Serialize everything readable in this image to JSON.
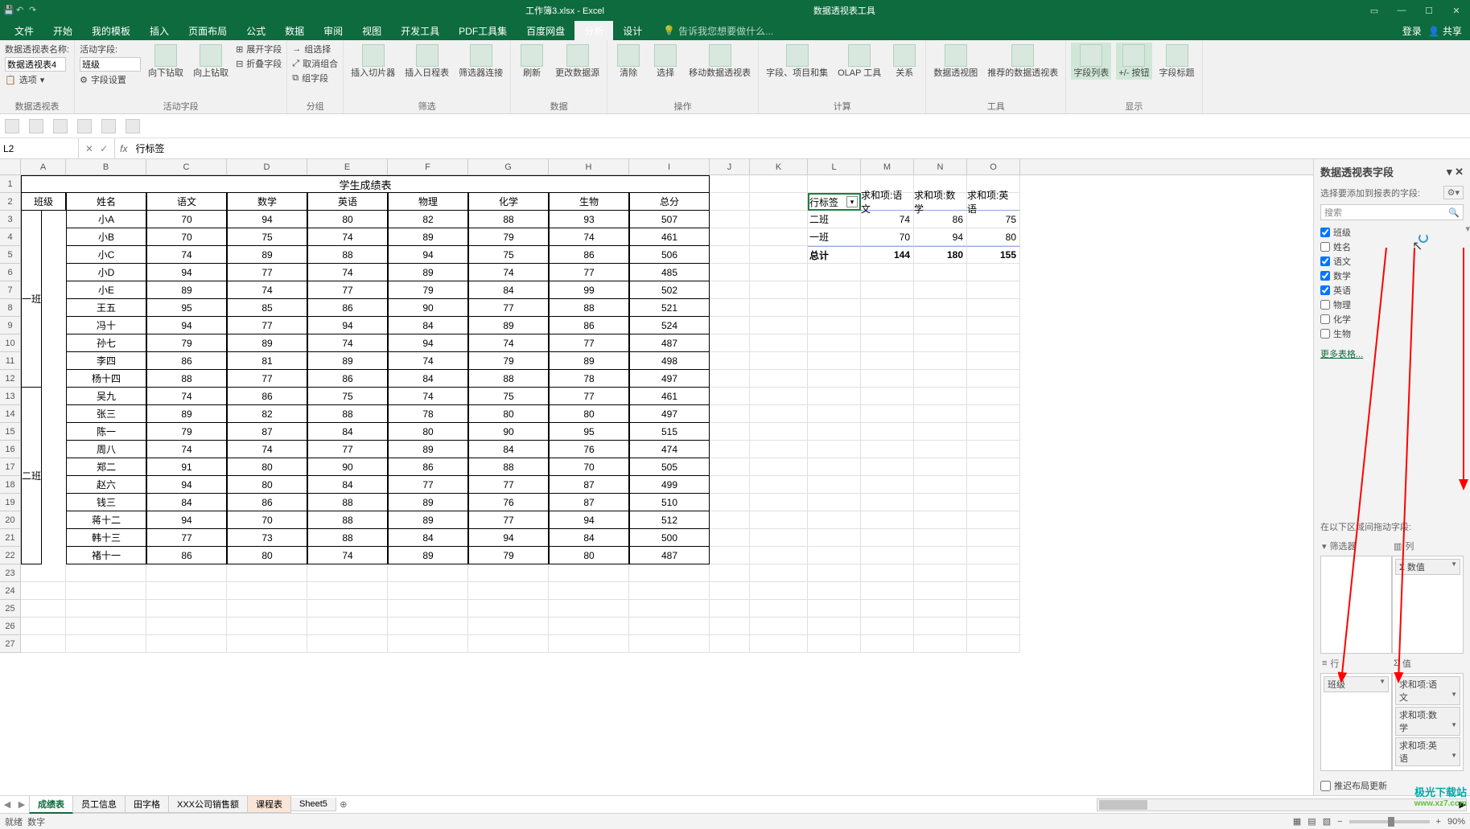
{
  "titlebar": {
    "filename": "工作簿3.xlsx - Excel",
    "context_title": "数据透视表工具",
    "login": "登录",
    "share": "共享"
  },
  "tabs": {
    "file": "文件",
    "home": "开始",
    "templates": "我的模板",
    "insert": "插入",
    "layout": "页面布局",
    "formulas": "公式",
    "data": "数据",
    "review": "审阅",
    "view": "视图",
    "dev": "开发工具",
    "pdf": "PDF工具集",
    "baidu": "百度网盘",
    "analyze": "分析",
    "design": "设计",
    "tell_me": "告诉我您想要做什么..."
  },
  "ribbon": {
    "pt_name_label": "数据透视表名称:",
    "pt_name_value": "数据透视表4",
    "options_btn": "选项",
    "group_pt": "数据透视表",
    "active_field_label": "活动字段:",
    "active_field_value": "班级",
    "field_settings": "字段设置",
    "drill_down": "向下钻取",
    "drill_up": "向上钻取",
    "expand_field": "展开字段",
    "collapse_field": "折叠字段",
    "group_active": "活动字段",
    "group_sel": "组选择",
    "ungroup": "取消组合",
    "group_field": "组字段",
    "group_group": "分组",
    "slicer": "插入切片器",
    "timeline": "插入日程表",
    "filter_conn": "筛选器连接",
    "group_filter": "筛选",
    "refresh": "刷新",
    "change_src": "更改数据源",
    "group_data": "数据",
    "clear": "清除",
    "select": "选择",
    "move": "移动数据透视表",
    "group_actions": "操作",
    "fields_items": "字段、项目和集",
    "olap": "OLAP 工具",
    "relations": "关系",
    "group_calc": "计算",
    "pivot_chart": "数据透视图",
    "recommended": "推荐的数据透视表",
    "group_tools": "工具",
    "field_list": "字段列表",
    "pm_buttons": "+/- 按钮",
    "field_headers": "字段标题",
    "group_show": "显示"
  },
  "namebox": "L2",
  "fx_value": "行标签",
  "columns": [
    "A",
    "B",
    "C",
    "D",
    "E",
    "F",
    "G",
    "H",
    "I",
    "J",
    "K",
    "L",
    "M",
    "N",
    "O"
  ],
  "table": {
    "title": "学生成绩表",
    "headers": [
      "班级",
      "姓名",
      "语文",
      "数学",
      "英语",
      "物理",
      "化学",
      "生物",
      "总分"
    ],
    "class1": "一班",
    "class2": "二班",
    "rows1": [
      [
        "小A",
        "70",
        "94",
        "80",
        "82",
        "88",
        "93",
        "507"
      ],
      [
        "小B",
        "70",
        "75",
        "74",
        "89",
        "79",
        "74",
        "461"
      ],
      [
        "小C",
        "74",
        "89",
        "88",
        "94",
        "75",
        "86",
        "506"
      ],
      [
        "小D",
        "94",
        "77",
        "74",
        "89",
        "74",
        "77",
        "485"
      ],
      [
        "小E",
        "89",
        "74",
        "77",
        "79",
        "84",
        "99",
        "502"
      ],
      [
        "王五",
        "95",
        "85",
        "86",
        "90",
        "77",
        "88",
        "521"
      ],
      [
        "冯十",
        "94",
        "77",
        "94",
        "84",
        "89",
        "86",
        "524"
      ],
      [
        "孙七",
        "79",
        "89",
        "74",
        "94",
        "74",
        "77",
        "487"
      ],
      [
        "李四",
        "86",
        "81",
        "89",
        "74",
        "79",
        "89",
        "498"
      ],
      [
        "杨十四",
        "88",
        "77",
        "86",
        "84",
        "88",
        "78",
        "497"
      ]
    ],
    "rows2": [
      [
        "吴九",
        "74",
        "86",
        "75",
        "74",
        "75",
        "77",
        "461"
      ],
      [
        "张三",
        "89",
        "82",
        "88",
        "78",
        "80",
        "80",
        "497"
      ],
      [
        "陈一",
        "79",
        "87",
        "84",
        "80",
        "90",
        "95",
        "515"
      ],
      [
        "周八",
        "74",
        "74",
        "77",
        "89",
        "84",
        "76",
        "474"
      ],
      [
        "郑二",
        "91",
        "80",
        "90",
        "86",
        "88",
        "70",
        "505"
      ],
      [
        "赵六",
        "94",
        "80",
        "84",
        "77",
        "77",
        "87",
        "499"
      ],
      [
        "钱三",
        "84",
        "86",
        "88",
        "89",
        "76",
        "87",
        "510"
      ],
      [
        "蒋十二",
        "94",
        "70",
        "88",
        "89",
        "77",
        "94",
        "512"
      ],
      [
        "韩十三",
        "77",
        "73",
        "88",
        "84",
        "94",
        "84",
        "500"
      ],
      [
        "褚十一",
        "86",
        "80",
        "74",
        "89",
        "79",
        "80",
        "487"
      ]
    ]
  },
  "pivot": {
    "row_label": "行标签",
    "cols": [
      "求和项:语文",
      "求和项:数学",
      "求和项:英语"
    ],
    "r1": [
      "二班",
      "74",
      "86",
      "75"
    ],
    "r2": [
      "一班",
      "70",
      "94",
      "80"
    ],
    "total_lbl": "总计",
    "totals": [
      "144",
      "180",
      "155"
    ]
  },
  "fieldpane": {
    "title": "数据透视表字段",
    "subtitle": "选择要添加到报表的字段:",
    "search_ph": "搜索",
    "fields": [
      {
        "name": "班级",
        "checked": true
      },
      {
        "name": "姓名",
        "checked": false
      },
      {
        "name": "语文",
        "checked": true
      },
      {
        "name": "数学",
        "checked": true
      },
      {
        "name": "英语",
        "checked": true
      },
      {
        "name": "物理",
        "checked": false
      },
      {
        "name": "化学",
        "checked": false
      },
      {
        "name": "生物",
        "checked": false
      }
    ],
    "more_tables": "更多表格...",
    "drag_label": "在以下区域间拖动字段:",
    "area_filter": "筛选器",
    "area_cols": "列",
    "area_rows": "行",
    "area_vals": "值",
    "col_chip": "Σ 数值",
    "row_chip": "班级",
    "val_chips": [
      "求和项:语文",
      "求和项:数学",
      "求和项:英语"
    ],
    "defer": "推迟布局更新"
  },
  "sheets": {
    "s1": "成绩表",
    "s2": "员工信息",
    "s3": "田字格",
    "s4": "XXX公司销售额",
    "s5": "课程表",
    "s6": "Sheet5"
  },
  "status": {
    "ready": "就绪",
    "num": "数字",
    "zoom": "90%"
  },
  "watermark": {
    "l1": "极光下载站",
    "l2": "www.xz7.com"
  }
}
